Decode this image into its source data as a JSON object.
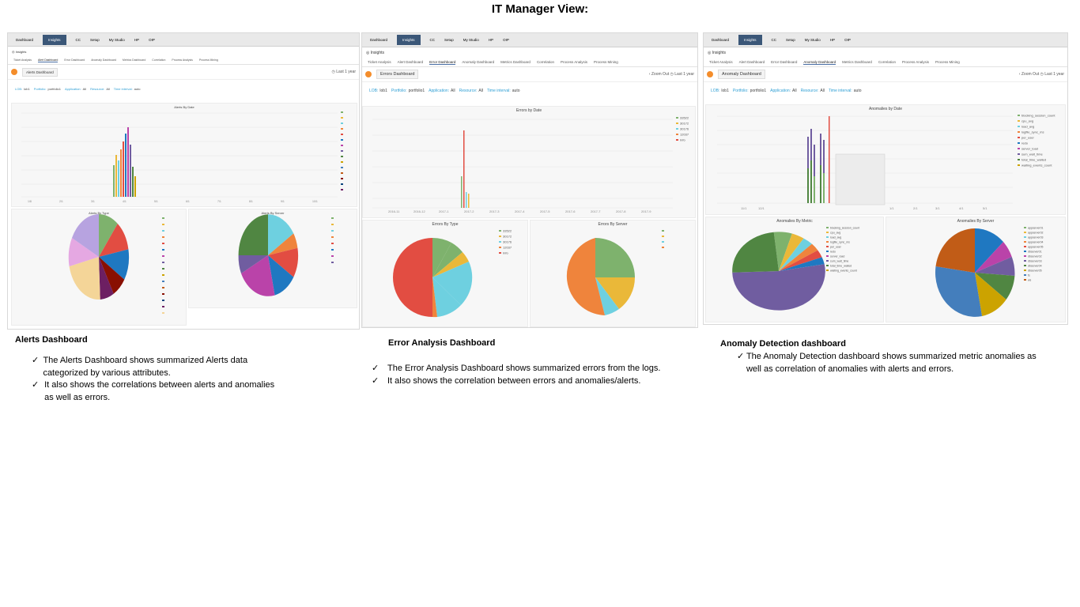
{
  "page_title": "IT Manager View:",
  "panels": [
    {
      "nav": [
        "Dashboard",
        "Insights",
        "CC",
        "Setup",
        "My Studio",
        "HP",
        "OIP"
      ],
      "insights_label": "◎ Insights",
      "tabs": [
        "Ticket Analysis",
        "Alert Dashboard",
        "Error Dashboard",
        "Anomaly Dashboard",
        "Metrics Dashboard",
        "Correlation",
        "Process Analysis",
        "Process Mining"
      ],
      "dashboard": "Alerts Dashboard",
      "time": "◷ Last 1 year",
      "filters": [
        {
          "l": "LOB:",
          "v": "lob1"
        },
        {
          "l": "Portfolio:",
          "v": "portfolio1"
        },
        {
          "l": "Application:",
          "v": "All"
        },
        {
          "l": "Resource:",
          "v": "All"
        },
        {
          "l": "Time interval:",
          "v": "auto"
        }
      ],
      "chart_titles": [
        "Alerts By Date",
        "Alerts By Type",
        "Alerts By Server"
      ]
    },
    {
      "nav": [
        "Dashboard",
        "Insights",
        "CC",
        "Setup",
        "My Studio",
        "HP",
        "OIP"
      ],
      "insights_label": "◎ Insights",
      "tabs": [
        "Ticket Analysis",
        "Alert Dashboard",
        "Error Dashboard",
        "Anomaly Dashboard",
        "Metrics Dashboard",
        "Correlation",
        "Process Analysis",
        "Process Mining"
      ],
      "dashboard": "Errors Dashboard",
      "time": "‹ Zoom Out  ◷ Last 1 year",
      "filters": [
        {
          "l": "LOB:",
          "v": "lob1"
        },
        {
          "l": "Portfolio:",
          "v": "portfolio1"
        },
        {
          "l": "Application:",
          "v": "All"
        },
        {
          "l": "Resource:",
          "v": "All"
        },
        {
          "l": "Time interval:",
          "v": "auto"
        }
      ],
      "chart_titles": [
        "Errors by Date",
        "Errors By Type",
        "Errors By Server"
      ],
      "legend": [
        "33522",
        "30172",
        "30176",
        "12037",
        "Info"
      ]
    },
    {
      "nav": [
        "Dashboard",
        "Insights",
        "CC",
        "Setup",
        "My Studio",
        "HP",
        "OIP"
      ],
      "insights_label": "◎ Insights",
      "tabs": [
        "Ticket Analysis",
        "Alert Dashboard",
        "Error Dashboard",
        "Anomaly Dashboard",
        "Metrics Dashboard",
        "Correlation",
        "Process Analysis",
        "Process Mining"
      ],
      "dashboard": "Anomaly Dashboard",
      "time": "‹ Zoom Out  ◷ Last 1 year",
      "filters": [
        {
          "l": "LOB:",
          "v": "lob1"
        },
        {
          "l": "Portfolio:",
          "v": "portfolio1"
        },
        {
          "l": "Application:",
          "v": "All"
        },
        {
          "l": "Resource:",
          "v": "All"
        },
        {
          "l": "Time interval:",
          "v": "auto"
        }
      ],
      "chart_titles": [
        "Anomalies by Date",
        "Anomalies By Metric",
        "Anomalies By Server"
      ],
      "legend": [
        "blocking_session_count",
        "cpu_avg",
        "load_avg",
        "logfile_sync_ms",
        "per_user",
        "redo",
        "server_load",
        "sum_wait_time",
        "total_time_waited",
        "waiting_events_count"
      ],
      "servers": [
        "appserver01",
        "appserver02",
        "appserver03",
        "appserver04",
        "appserver05",
        "dbserver01",
        "dbserver02",
        "dbserver03",
        "dbserver04",
        "dbserver05",
        "fs",
        "ws"
      ]
    }
  ],
  "captions": [
    {
      "title": "Alerts Dashboard",
      "bullets": [
        "The Alerts Dashboard shows summarized Alerts data categorized by various attributes.",
        "It also shows the correlations between alerts and anomalies as well as errors."
      ]
    },
    {
      "title": "Error Analysis Dashboard",
      "bullets": [
        "The Error Analysis Dashboard shows summarized errors from the logs.",
        " It also shows the correlation between errors and anomalies/alerts."
      ]
    },
    {
      "title": "Anomaly Detection dashboard",
      "bullets": [
        "The Anomaly Detection dashboard shows summarized metric anomalies as well as correlation of anomalies with alerts and errors."
      ]
    }
  ],
  "checkmark": "✓"
}
